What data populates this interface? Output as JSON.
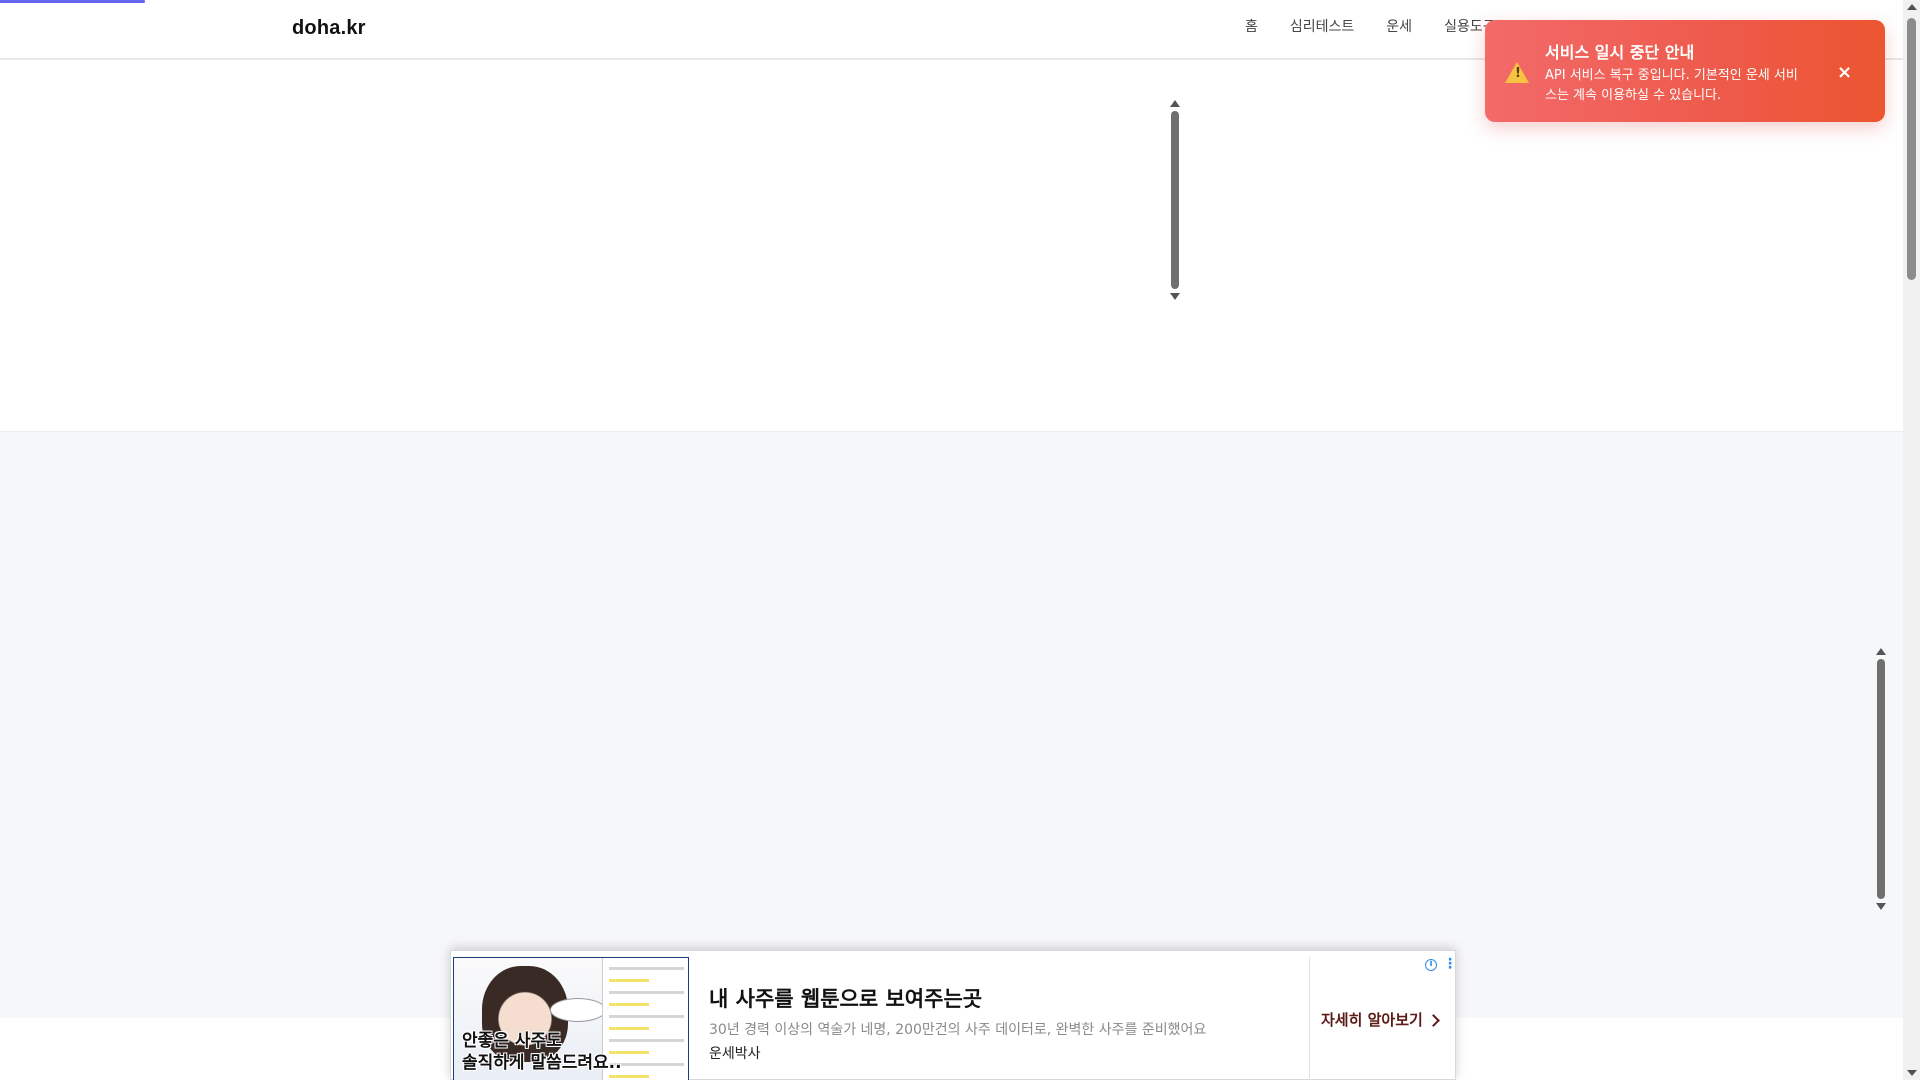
{
  "site": {
    "logo": "doha.kr"
  },
  "nav": {
    "items": [
      "홈",
      "심리테스트",
      "운세",
      "실용도구"
    ]
  },
  "toast": {
    "title": "서비스 일시 중단 안내",
    "message": "API 서비스 복구 중입니다. 기본적인 운세 서비스는 계속 이용하실 수 있습니다.",
    "close_label": "×",
    "icon": "warning-icon",
    "icon_glyph": "!"
  },
  "ad": {
    "image_caption_line1": "안좋은 사주도",
    "image_caption_line2": "솔직하게 말씀드려요..",
    "headline": "내 사주를 웹툰으로 보여주는곳",
    "description": "30년 경력 이상의 역술가 네명, 200만건의 사주 데이터로, 완벽한 사주를 준비했어요",
    "advertiser": "운세박사",
    "cta": "자세히 알아보기",
    "info_glyph": "i",
    "more_glyph": "⋮"
  },
  "colors": {
    "progress": "#6366f1",
    "toast_start": "#f26a6a",
    "toast_end": "#ec5530",
    "warning": "#f6c342",
    "content_bg": "#f6f7f9"
  }
}
